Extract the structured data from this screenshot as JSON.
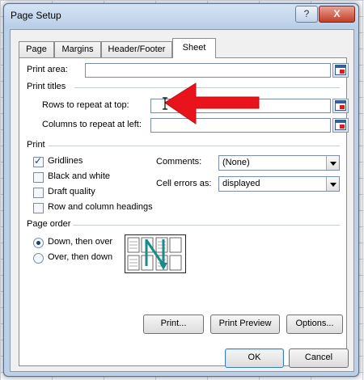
{
  "window": {
    "title": "Page Setup",
    "help_label": "?",
    "close_label": "X"
  },
  "tabs": [
    {
      "label": "Page",
      "active": false
    },
    {
      "label": "Margins",
      "active": false
    },
    {
      "label": "Header/Footer",
      "active": false
    },
    {
      "label": "Sheet",
      "active": true
    }
  ],
  "print_area": {
    "label": "Print area:",
    "value": ""
  },
  "print_titles": {
    "group_label": "Print titles",
    "rows_label": "Rows to repeat at top:",
    "rows_value": "",
    "columns_label": "Columns to repeat at left:",
    "columns_value": ""
  },
  "print": {
    "group_label": "Print",
    "gridlines": {
      "label": "Gridlines",
      "checked": true
    },
    "black_white": {
      "label": "Black and white",
      "checked": false
    },
    "draft_quality": {
      "label": "Draft quality",
      "checked": false
    },
    "row_col_headings": {
      "label": "Row and column headings",
      "checked": false
    },
    "comments_label": "Comments:",
    "comments_value": "(None)",
    "cell_errors_label": "Cell errors as:",
    "cell_errors_value": "displayed"
  },
  "page_order": {
    "group_label": "Page order",
    "down_then_over": {
      "label": "Down, then over",
      "selected": true
    },
    "over_then_down": {
      "label": "Over, then down",
      "selected": false
    }
  },
  "buttons": {
    "print": "Print...",
    "print_preview": "Print Preview",
    "options": "Options...",
    "ok": "OK",
    "cancel": "Cancel"
  },
  "colors": {
    "annotation_arrow": "#e8131b",
    "page_order_arrow": "#1a8a8a"
  }
}
